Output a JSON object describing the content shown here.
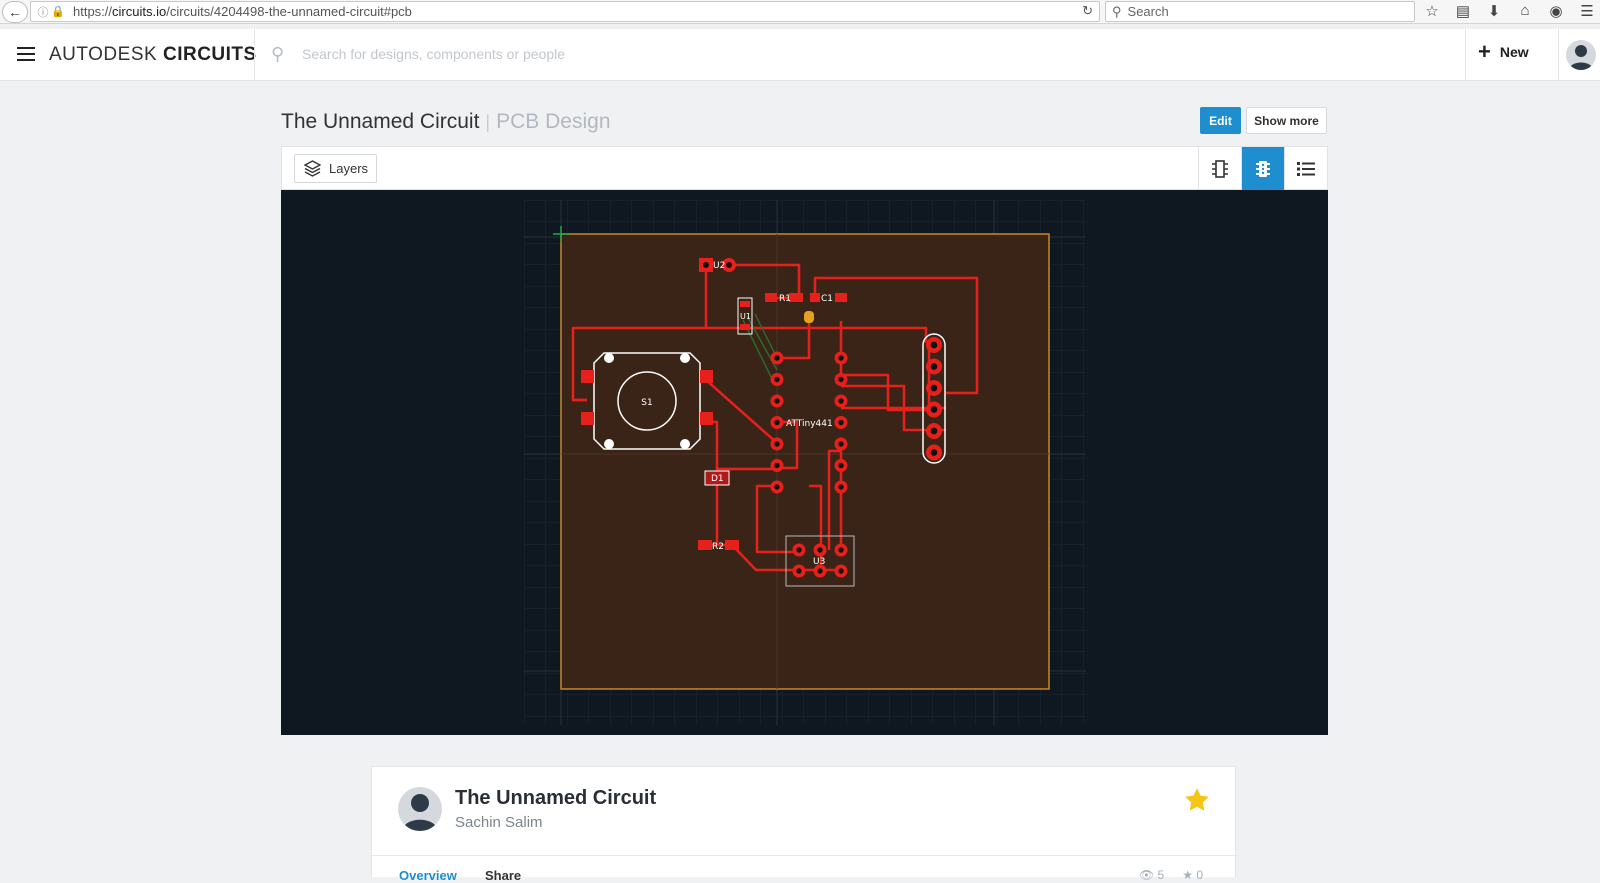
{
  "browser": {
    "url_prefix": "https://",
    "url_domain": "circuits.io",
    "url_path": "/circuits/4204498-the-unnamed-circuit#pcb",
    "search_placeholder": "Search"
  },
  "header": {
    "brand_light": "AUTODESK ",
    "brand_bold": "CIRCUITS",
    "search_placeholder": "Search for designs, components or people",
    "new_label": "New"
  },
  "page": {
    "title": "The Unnamed Circuit",
    "separator": "|",
    "subtitle": "PCB Design",
    "edit_label": "Edit",
    "show_more_label": "Show more"
  },
  "viewer": {
    "layers_label": "Layers"
  },
  "pcb": {
    "labels": {
      "u2": "U2",
      "r1": "R1",
      "c1": "C1",
      "u1": "U1",
      "s1": "S1",
      "attiny": "ATTiny441",
      "d1": "D1",
      "r2": "R2",
      "u3": "U3"
    },
    "colors": {
      "background": "#0f1821",
      "board": "#3a2417",
      "board_outline": "#c8862a",
      "trace": "#e8201c",
      "pad": "#e8201c",
      "silkscreen": "#ffffff"
    }
  },
  "card": {
    "title": "The Unnamed Circuit",
    "author": "Sachin Salim",
    "tab_overview": "Overview",
    "tab_share": "Share",
    "views": "5",
    "stars": "0",
    "star_color": "#f5c518"
  }
}
